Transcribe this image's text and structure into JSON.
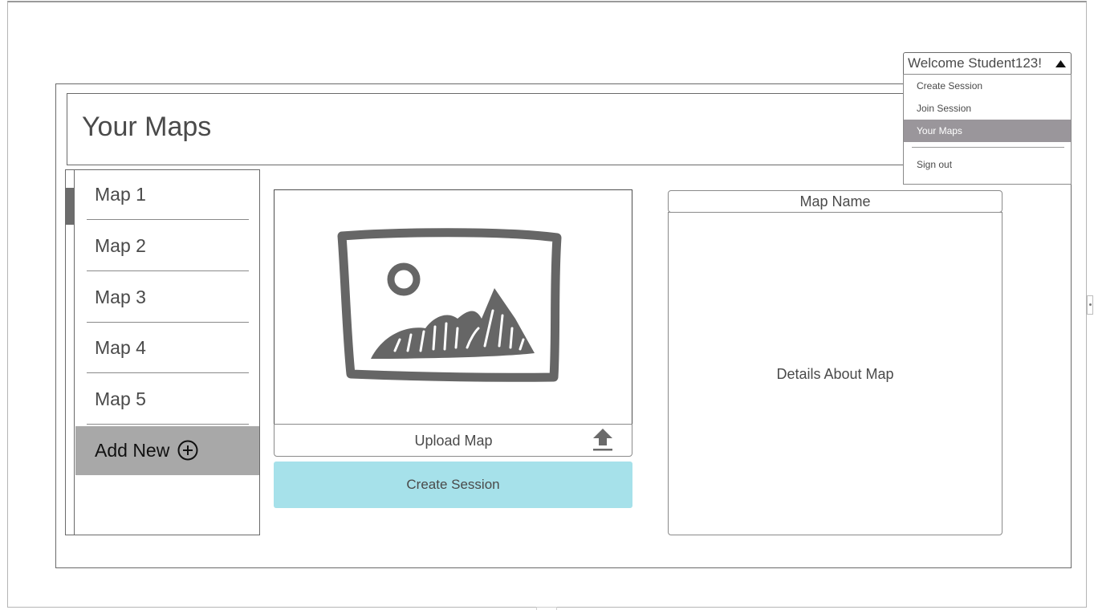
{
  "header": {
    "title": "Your Maps"
  },
  "sidebar": {
    "items": [
      {
        "label": "Map 1"
      },
      {
        "label": "Map 2"
      },
      {
        "label": "Map 3"
      },
      {
        "label": "Map 4"
      },
      {
        "label": "Map 5"
      }
    ],
    "add_new_label": "Add New"
  },
  "preview": {
    "image_icon": "sketched-image-placeholder-icon",
    "upload_label": "Upload Map",
    "upload_icon": "upload-arrow-icon",
    "create_session_label": "Create Session",
    "create_session_color": "#a6e1ea"
  },
  "details": {
    "map_name": "Map Name",
    "details_text": "Details About Map"
  },
  "user_menu": {
    "welcome": "Welcome Student123!",
    "toggle_icon": "caret-up-icon",
    "items": [
      {
        "label": "Create Session"
      },
      {
        "label": "Join Session"
      },
      {
        "label": "Your Maps",
        "selected": true
      },
      {
        "label": "Sign out"
      }
    ],
    "selected_color": "#9a969b"
  }
}
